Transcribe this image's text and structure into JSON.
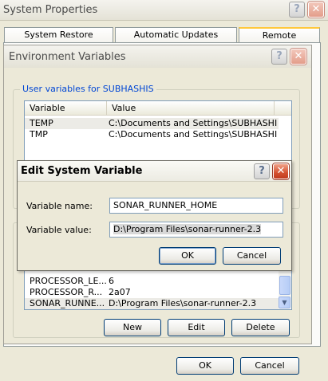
{
  "system_properties": {
    "title": "System Properties",
    "tabs": [
      "System Restore",
      "Automatic Updates",
      "Remote"
    ],
    "ok_label": "OK",
    "cancel_label": "Cancel"
  },
  "env_vars": {
    "title": "Environment Variables",
    "user_group_label": "User variables for SUBHASHIS",
    "columns": [
      "Variable",
      "Value"
    ],
    "user_rows": [
      {
        "variable": "TEMP",
        "value": "C:\\Documents and Settings\\SUBHASHIS ..."
      },
      {
        "variable": "TMP",
        "value": "C:\\Documents and Settings\\SUBHASHIS ..."
      }
    ],
    "system_rows": [
      {
        "variable": "PROCESSOR_LE...",
        "value": "6"
      },
      {
        "variable": "PROCESSOR_R...",
        "value": "2a07"
      },
      {
        "variable": "SONAR_RUNNE...",
        "value": "D:\\Program Files\\sonar-runner-2.3"
      }
    ],
    "new_label": "New",
    "edit_label": "Edit",
    "delete_label": "Delete"
  },
  "edit_dialog": {
    "title": "Edit System Variable",
    "name_label": "Variable name:",
    "name_value": "SONAR_RUNNER_HOME",
    "value_label": "Variable value:",
    "value_value": "D:\\Program Files\\sonar-runner-2.3",
    "ok_label": "OK",
    "cancel_label": "Cancel"
  },
  "title_buttons": {
    "help": "?",
    "close": "✕"
  },
  "scroll_glyphs": {
    "up": "▲",
    "down": "▼"
  }
}
